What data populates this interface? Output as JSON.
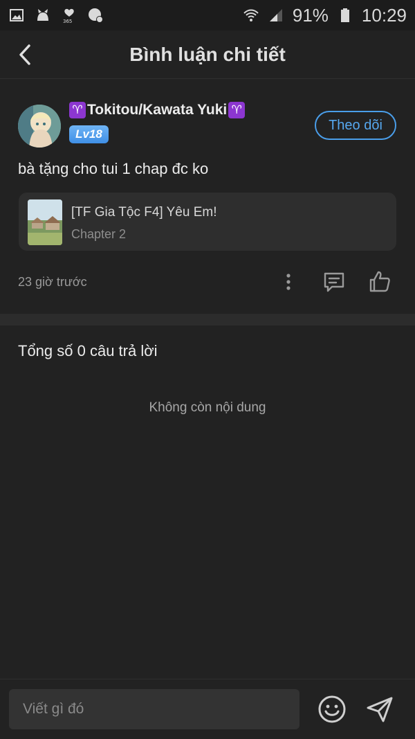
{
  "status": {
    "battery": "91%",
    "time": "10:29"
  },
  "header": {
    "title": "Bình luận chi tiết"
  },
  "comment": {
    "username": "Tokitou/Kawata Yuki",
    "badge_symbol": "♈",
    "level": "Lv18",
    "follow_label": "Theo dõi",
    "text": "bà tặng cho tui 1 chap đc ko",
    "manga": {
      "title": "[TF Gia Tộc F4] Yêu Em!",
      "chapter": "Chapter 2"
    },
    "time": "23 giờ trước"
  },
  "replies": {
    "total_label": "Tổng số 0 câu trả lời",
    "empty_label": "Không còn nội dung"
  },
  "composer": {
    "placeholder": "Viết gì đó"
  },
  "colors": {
    "accent": "#4a9eea",
    "background": "#222222",
    "card": "#2e2e2e",
    "badge": "#8c36d0"
  },
  "icons": [
    "gallery-icon",
    "cat-icon",
    "health-icon",
    "chat-icon",
    "wifi-icon",
    "signal-icon",
    "battery-icon",
    "back-icon",
    "more-icon",
    "reply-icon",
    "like-icon",
    "emoji-icon",
    "send-icon"
  ]
}
